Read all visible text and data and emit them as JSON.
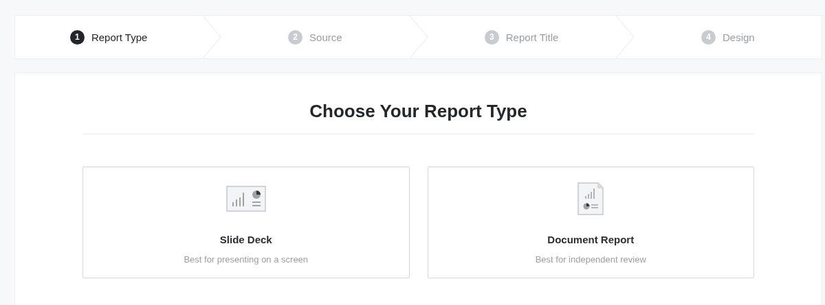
{
  "steps": [
    {
      "number": "1",
      "label": "Report Type",
      "selected": true
    },
    {
      "number": "2",
      "label": "Source",
      "selected": false
    },
    {
      "number": "3",
      "label": "Report Title",
      "selected": false
    },
    {
      "number": "4",
      "label": "Design",
      "selected": false
    }
  ],
  "heading": "Choose Your Report Type",
  "options": [
    {
      "kind": "slides",
      "title": "Slide Deck",
      "description": "Best for presenting on a screen"
    },
    {
      "kind": "document",
      "title": "Document Report",
      "description": "Best for independent review"
    }
  ]
}
